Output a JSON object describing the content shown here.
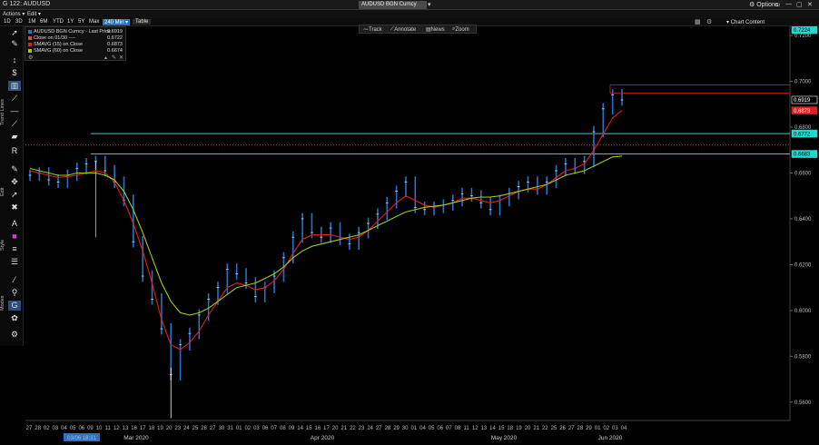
{
  "window": {
    "title": "G 122: AUDUSD",
    "ticker_box": "AUDUSD BGN Curncy",
    "options_label": "Options",
    "win_buttons": [
      "▭",
      "—",
      "▢",
      "✕"
    ]
  },
  "menu": {
    "actions": "Actions ▾",
    "edit": "Edit ▾"
  },
  "range_buttons": [
    "1D",
    "3D",
    "1M",
    "6M",
    "YTD",
    "1Y",
    "5Y",
    "Max"
  ],
  "range_active": "240 Min ▾",
  "range_table": "Table",
  "chart_content_label": "Chart Content",
  "top_tools": {
    "track": "Track",
    "annotate": "Annotate",
    "news": "News",
    "zoom": "Zoom"
  },
  "sidebar_labels": {
    "trend": "Trend Lines",
    "edit": "Edit",
    "style": "Style",
    "modes": "Modes"
  },
  "legend": {
    "rows": [
      {
        "label": "AUDUSD BGN Curncy - Last Price",
        "value": "0.6919",
        "color": "#2a72c8"
      },
      {
        "label": "Close on 01/30 ----",
        "value": "0.6722",
        "color": "#d84a2a"
      },
      {
        "label": "SMAVG (15)  on Close",
        "value": "0.6873",
        "color": "#e02020"
      },
      {
        "label": "SMAVG (60)  on Close",
        "value": "0.6674",
        "color": "#9ccc20"
      }
    ]
  },
  "price_axis": {
    "ticks": [
      "0.7200",
      "0.7000",
      "0.6800",
      "0.6600",
      "0.6400",
      "0.6200",
      "0.6000",
      "0.5800",
      "0.5600"
    ],
    "tags": [
      {
        "label": "0.7224",
        "color": "#20d8d0",
        "bg": "#20d8d0",
        "fg": "#000"
      },
      {
        "label": "0.6919",
        "color": "#ffffff",
        "bg": "#000000",
        "fg": "#fff"
      },
      {
        "label": "0.6873",
        "color": "#e02020",
        "bg": "#e02020",
        "fg": "#fff"
      },
      {
        "label": "0.6772",
        "color": "#20d8d0",
        "bg": "#20d8d0",
        "fg": "#000"
      },
      {
        "label": "0.6683",
        "color": "#20d8d0",
        "bg": "#20d8d0",
        "fg": "#000"
      }
    ]
  },
  "date_axis": {
    "days": [
      "27",
      "28",
      "02",
      "03",
      "04",
      "05",
      "06",
      "09",
      "10",
      "11",
      "12",
      "13",
      "16",
      "17",
      "18",
      "19",
      "20",
      "23",
      "24",
      "25",
      "26",
      "27",
      "30",
      "31",
      "01",
      "02",
      "03",
      "06",
      "07",
      "08",
      "09",
      "14",
      "15",
      "16",
      "17",
      "20",
      "21",
      "22",
      "23",
      "24",
      "27",
      "28",
      "29",
      "30",
      "01",
      "04",
      "05",
      "06",
      "07",
      "08",
      "11",
      "12",
      "13",
      "14",
      "15",
      "18",
      "19",
      "20",
      "21",
      "22",
      "25",
      "26",
      "27",
      "28",
      "29",
      "01",
      "02",
      "03",
      "04"
    ],
    "months": [
      "Mar 2020",
      "Apr 2020",
      "May 2020",
      "Jun 2020"
    ],
    "cursor_label": "03/06 18:31"
  },
  "chart_data": {
    "type": "line",
    "title": "",
    "series": [
      {
        "name": "AUDUSD BGN Curncy - Last Price",
        "color": "#2a72c8",
        "y": [
          0.659,
          0.66,
          0.657,
          0.656,
          0.659,
          0.662,
          0.664,
          0.665,
          0.661,
          0.656,
          0.648,
          0.63,
          0.615,
          0.605,
          0.592,
          0.572,
          0.585,
          0.59,
          0.598,
          0.605,
          0.61,
          0.618,
          0.616,
          0.612,
          0.606,
          0.61,
          0.615,
          0.623,
          0.632,
          0.64,
          0.634,
          0.632,
          0.636,
          0.631,
          0.629,
          0.634,
          0.638,
          0.642,
          0.647,
          0.652,
          0.656,
          0.645,
          0.644,
          0.645,
          0.646,
          0.648,
          0.651,
          0.65,
          0.647,
          0.644,
          0.648,
          0.651,
          0.654,
          0.656,
          0.653,
          0.656,
          0.661,
          0.664,
          0.662,
          0.665,
          0.678,
          0.688,
          0.694,
          0.6919
        ]
      },
      {
        "name": "SMAVG (15)  on Close",
        "color": "#e02020",
        "y": [
          0.661,
          0.66,
          0.659,
          0.658,
          0.6585,
          0.659,
          0.66,
          0.661,
          0.66,
          0.656,
          0.648,
          0.638,
          0.626,
          0.612,
          0.596,
          0.585,
          0.583,
          0.586,
          0.591,
          0.598,
          0.604,
          0.61,
          0.612,
          0.611,
          0.609,
          0.61,
          0.613,
          0.618,
          0.625,
          0.631,
          0.633,
          0.633,
          0.633,
          0.632,
          0.631,
          0.632,
          0.635,
          0.639,
          0.643,
          0.647,
          0.65,
          0.648,
          0.646,
          0.645,
          0.646,
          0.647,
          0.649,
          0.649,
          0.648,
          0.647,
          0.648,
          0.65,
          0.652,
          0.653,
          0.653,
          0.655,
          0.658,
          0.661,
          0.662,
          0.664,
          0.67,
          0.677,
          0.684,
          0.6873
        ]
      },
      {
        "name": "SMAVG (60)  on Close",
        "color": "#9ccc20",
        "y": [
          0.662,
          0.661,
          0.66,
          0.659,
          0.659,
          0.66,
          0.66,
          0.66,
          0.659,
          0.657,
          0.652,
          0.644,
          0.634,
          0.623,
          0.612,
          0.604,
          0.599,
          0.598,
          0.599,
          0.601,
          0.604,
          0.607,
          0.61,
          0.611,
          0.612,
          0.614,
          0.616,
          0.619,
          0.623,
          0.626,
          0.628,
          0.629,
          0.63,
          0.631,
          0.632,
          0.633,
          0.635,
          0.637,
          0.639,
          0.641,
          0.643,
          0.644,
          0.645,
          0.6455,
          0.646,
          0.647,
          0.648,
          0.649,
          0.6495,
          0.6495,
          0.65,
          0.651,
          0.652,
          0.653,
          0.654,
          0.655,
          0.657,
          0.659,
          0.66,
          0.661,
          0.663,
          0.665,
          0.667,
          0.6674
        ]
      }
    ],
    "levels": [
      {
        "value": 0.6722,
        "color": "#d84a2a",
        "style": "dotted"
      },
      {
        "value": 0.6772,
        "color": "#20d8d0",
        "style": "solid"
      },
      {
        "value": 0.6683,
        "color": "#20d8d0",
        "style": "solid"
      }
    ],
    "ylim": [
      0.552,
      0.724
    ],
    "grid": false,
    "legend_position": "top-left"
  }
}
